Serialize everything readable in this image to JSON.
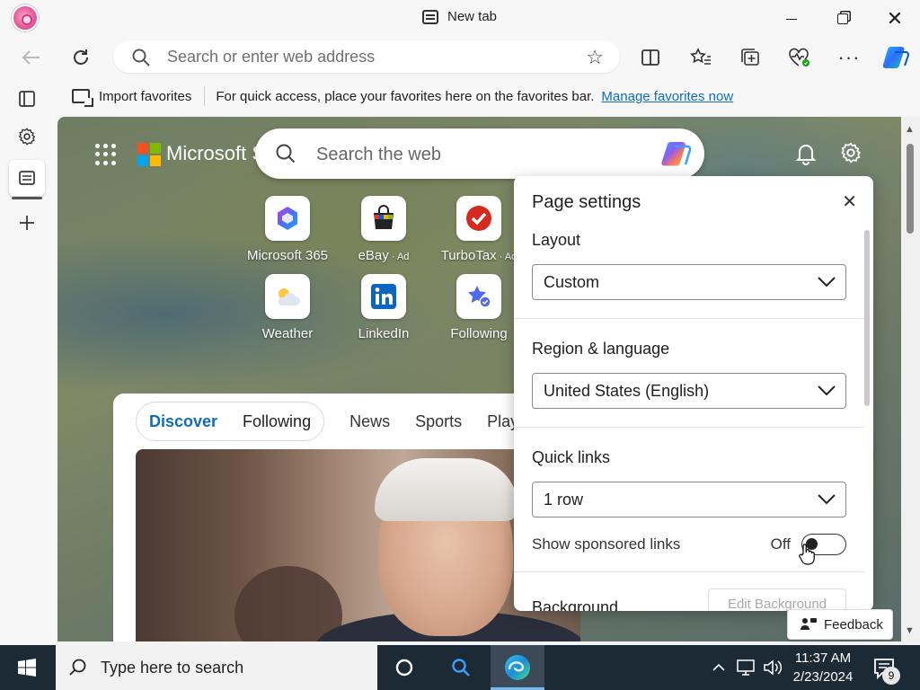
{
  "window": {
    "tab_title": "New tab",
    "minimize_glyph": "—",
    "close_glyph": "✕"
  },
  "toolbar": {
    "address_placeholder": "Search or enter web address"
  },
  "favorites_bar": {
    "import_label": "Import favorites",
    "message": "For quick access, place your favorites here on the favorites bar.",
    "manage_link": "Manage favorites now"
  },
  "ntp": {
    "brand": "Microsoft S",
    "search_placeholder": "Search the web",
    "quick_links": [
      {
        "label": "Microsoft 365",
        "ad": "",
        "icon": "microsoft-365-icon"
      },
      {
        "label": "eBay",
        "ad": " · Ad",
        "icon": "ebay-icon"
      },
      {
        "label": "TurboTax",
        "ad": " · Ad",
        "icon": "turbotax-icon"
      },
      {
        "label": "Weather",
        "ad": "",
        "icon": "weather-icon"
      },
      {
        "label": "LinkedIn",
        "ad": "",
        "icon": "linkedin-icon"
      },
      {
        "label": "Following",
        "ad": "",
        "icon": "following-icon"
      }
    ],
    "feed_tabs": {
      "discover": "Discover",
      "following": "Following",
      "news": "News",
      "sports": "Sports",
      "play": "Play"
    }
  },
  "page_settings": {
    "title": "Page settings",
    "layout_label": "Layout",
    "layout_value": "Custom",
    "region_label": "Region & language",
    "region_value": "United States (English)",
    "quick_links_label": "Quick links",
    "quick_links_value": "1 row",
    "sponsored_label": "Show sponsored links",
    "sponsored_state": "Off",
    "background_label": "Background",
    "edit_background": "Edit Background"
  },
  "feedback": {
    "label": "Feedback"
  },
  "taskbar": {
    "search_placeholder": "Type here to search",
    "time": "11:37 AM",
    "date": "2/23/2024",
    "notification_count": "9"
  },
  "colors": {
    "accent": "#0f6cbd",
    "taskbar_bg": "#1c2a36"
  }
}
